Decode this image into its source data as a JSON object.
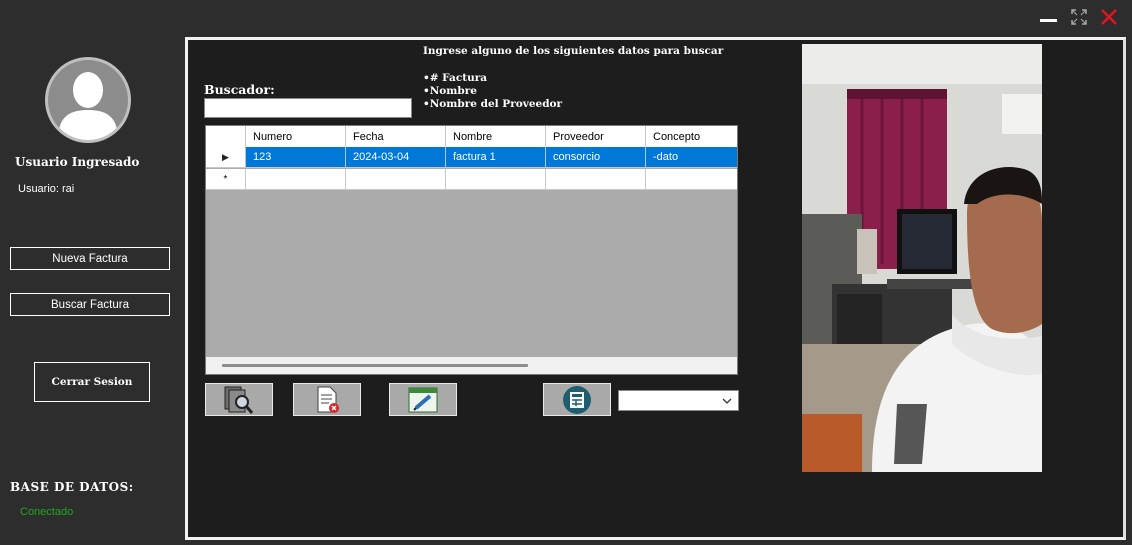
{
  "window": {
    "minimize_icon": "minimize-icon",
    "maximize_icon": "maximize-icon",
    "close_icon": "close-icon",
    "close_color": "#e81123"
  },
  "sidebar": {
    "title": "Usuario Ingresado",
    "user_text": "Usuario: rai",
    "nueva_factura": "Nueva Factura",
    "buscar_factura": "Buscar Factura",
    "cerrar_sesion": "Cerrar Sesion",
    "db_title": "BASE DE DATOS:",
    "db_status": "Conectado",
    "db_status_color": "#1fa81f"
  },
  "search": {
    "instruction": "Ingrese alguno de los siguientes datos para buscar",
    "options": [
      "•# Factura",
      "•Nombre",
      "•Nombre del Proveedor"
    ],
    "label": "Buscador:",
    "value": ""
  },
  "grid": {
    "columns": [
      "Numero",
      "Fecha",
      "Nombre",
      "Proveedor",
      "Concepto"
    ],
    "rows": [
      {
        "numero": "123",
        "fecha": "2024-03-04",
        "nombre": "factura 1",
        "proveedor": "consorcio",
        "concepto": "-dato"
      }
    ],
    "selection_color": "#0078d7",
    "row_indicator": "▶",
    "new_row_indicator": "*"
  },
  "toolbar": {
    "icons": [
      "search-document-icon",
      "delete-document-icon",
      "edit-document-icon",
      "calculator-icon"
    ]
  },
  "dropdown": {
    "value": ""
  }
}
